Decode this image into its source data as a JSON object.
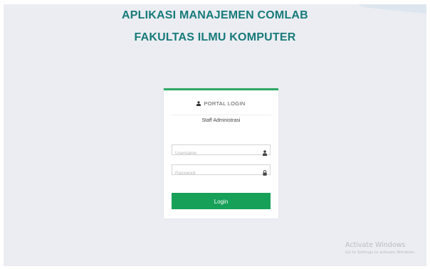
{
  "header": {
    "title_line1": "APLIKASI MANAJEMEN COMLAB",
    "title_line2": "FAKULTAS ILMU KOMPUTER"
  },
  "login": {
    "portal_title": "PORTAL LOGIN",
    "subtitle": "Staff Administrasi",
    "username_placeholder": "Username",
    "password_placeholder": "Password",
    "button_label": "Login",
    "icons": {
      "portal": "user-icon",
      "username": "user-icon",
      "password": "lock-icon"
    }
  },
  "watermark": {
    "line1": "Activate Windows",
    "line2": "Go to Settings to activate Windows."
  },
  "colors": {
    "title": "#177a7a",
    "accent": "#2fa866",
    "button": "#16a058",
    "background": "#ebedf2"
  }
}
